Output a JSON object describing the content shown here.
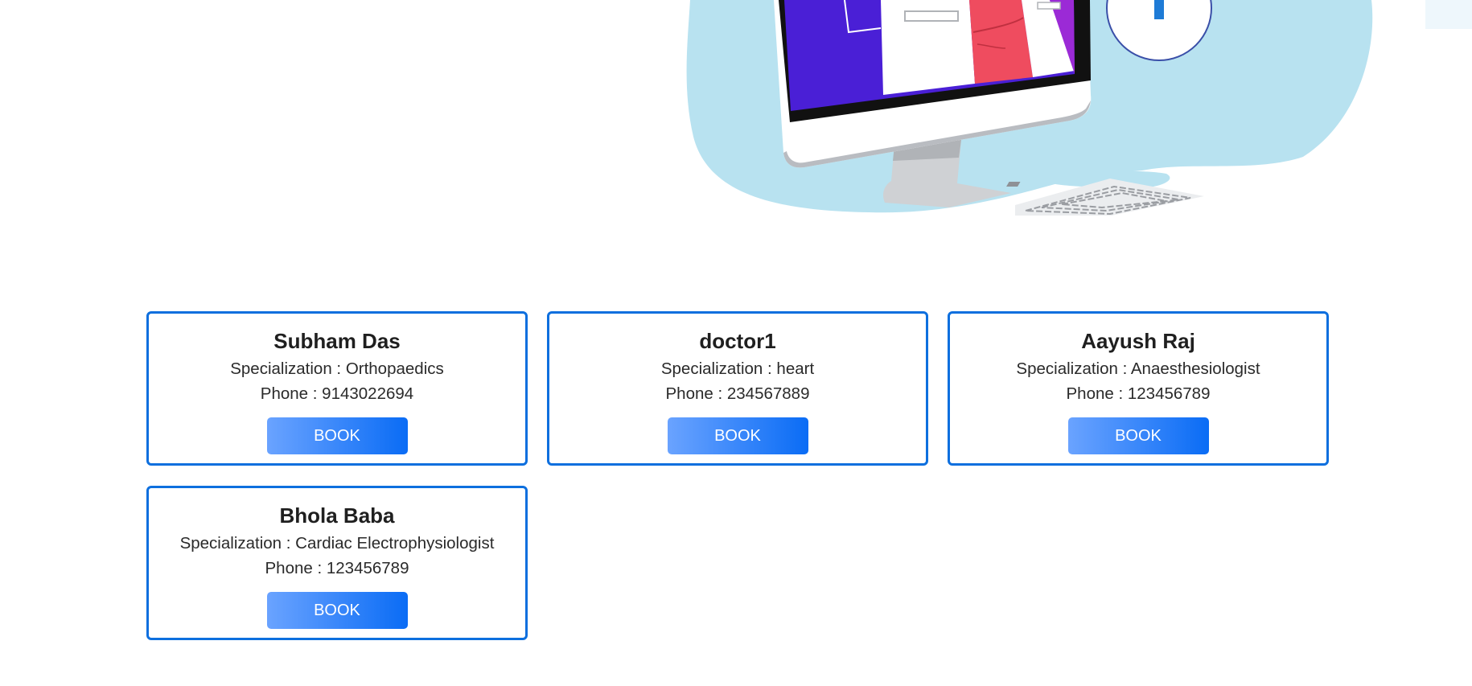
{
  "colors": {
    "card_border": "#0d6fde",
    "button_gradient_start": "#6aa3ff",
    "button_gradient_end": "#0a6cf5",
    "blob": "#b8e2f0"
  },
  "hero": {
    "illustration": "doctor-on-monitor-illustration"
  },
  "doctors": [
    {
      "name": "Subham Das",
      "specialization": "Specialization : Orthopaedics",
      "phone": "Phone : 9143022694",
      "button": "BOOK"
    },
    {
      "name": "doctor1",
      "specialization": "Specialization : heart",
      "phone": "Phone : 234567889",
      "button": "BOOK"
    },
    {
      "name": "Aayush Raj",
      "specialization": "Specialization : Anaesthesiologist",
      "phone": "Phone : 123456789",
      "button": "BOOK"
    },
    {
      "name": "Bhola Baba",
      "specialization": "Specialization : Cardiac Electrophysiologist",
      "phone": "Phone : 123456789",
      "button": "BOOK"
    }
  ]
}
